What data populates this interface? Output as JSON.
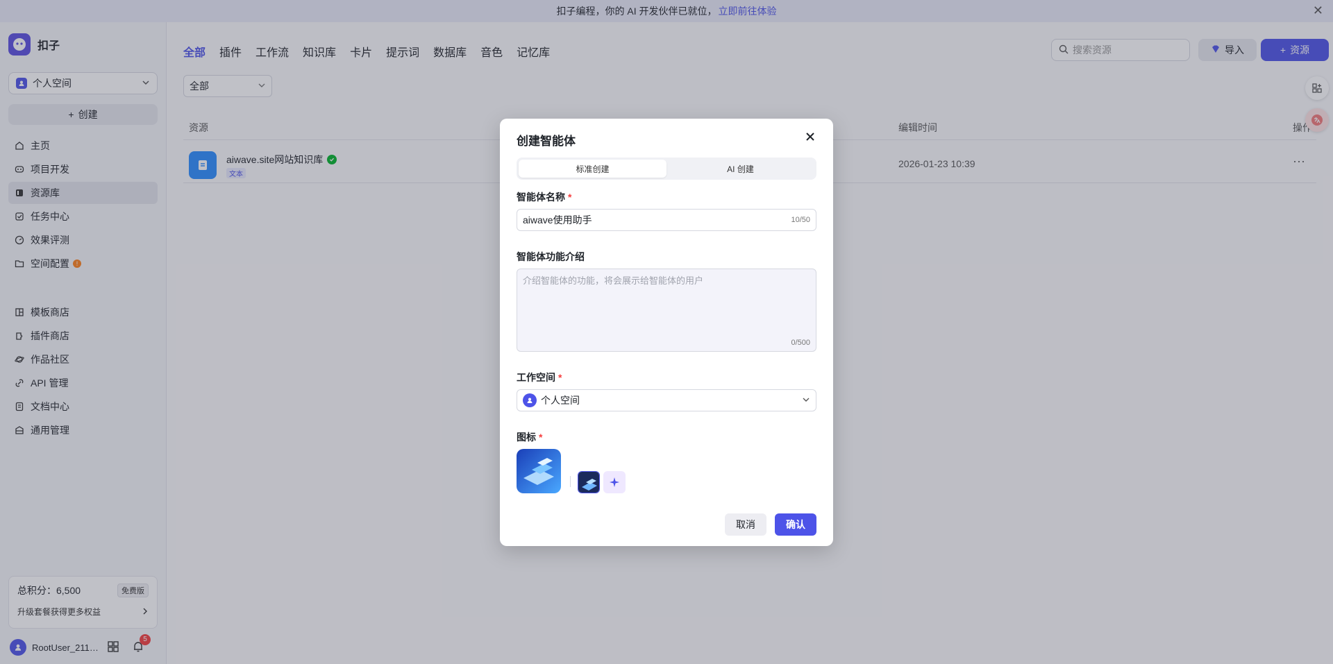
{
  "banner": {
    "text": "扣子编程，你的 AI 开发伙伴已就位，",
    "link": "立即前往体验",
    "close": "✕"
  },
  "sidebar": {
    "app_name": "扣子",
    "space": "个人空间",
    "create": "创建",
    "nav_primary": [
      {
        "label": "主页",
        "icon": "home-icon"
      },
      {
        "label": "项目开发",
        "icon": "project-icon"
      },
      {
        "label": "资源库",
        "icon": "library-icon"
      },
      {
        "label": "任务中心",
        "icon": "task-icon"
      },
      {
        "label": "效果评测",
        "icon": "evaluation-icon"
      },
      {
        "label": "空间配置",
        "icon": "space-config-icon"
      }
    ],
    "nav_secondary": [
      {
        "label": "模板商店",
        "icon": "template-icon"
      },
      {
        "label": "插件商店",
        "icon": "plugin-icon"
      },
      {
        "label": "作品社区",
        "icon": "community-icon"
      },
      {
        "label": "API 管理",
        "icon": "api-icon"
      },
      {
        "label": "文档中心",
        "icon": "docs-icon"
      },
      {
        "label": "通用管理",
        "icon": "settings-icon"
      }
    ],
    "points_label": "总积分：6,500",
    "plan_badge": "免费版",
    "upgrade_text": "升级套餐获得更多权益",
    "username": "RootUser_211…",
    "notification_count": "5"
  },
  "main": {
    "tabs": [
      "全部",
      "插件",
      "工作流",
      "知识库",
      "卡片",
      "提示词",
      "数据库",
      "音色",
      "记忆库"
    ],
    "search_placeholder": "搜索资源",
    "import_label": "导入",
    "resource_label": "资源",
    "filter_value": "全部",
    "columns": {
      "resource": "资源",
      "edit_time": "编辑时间",
      "actions": "操作"
    },
    "rows": [
      {
        "name": "aiwave.site网站知识库",
        "tag": "文本",
        "edit_time": "2026-01-23 10:39"
      }
    ]
  },
  "modal": {
    "title": "创建智能体",
    "tab_standard": "标准创建",
    "tab_ai": "AI 创建",
    "name_label": "智能体名称",
    "name_value": "aiwave使用助手",
    "name_count": "10/50",
    "desc_label": "智能体功能介绍",
    "desc_placeholder": "介绍智能体的功能，将会展示给智能体的用户",
    "desc_count": "0/500",
    "workspace_label": "工作空间",
    "workspace_value": "个人空间",
    "icon_label": "图标",
    "cancel": "取消",
    "confirm": "确认"
  },
  "colors": {
    "accent": "#4d53e8",
    "required": "#f53f3f",
    "success": "#00b42a"
  }
}
